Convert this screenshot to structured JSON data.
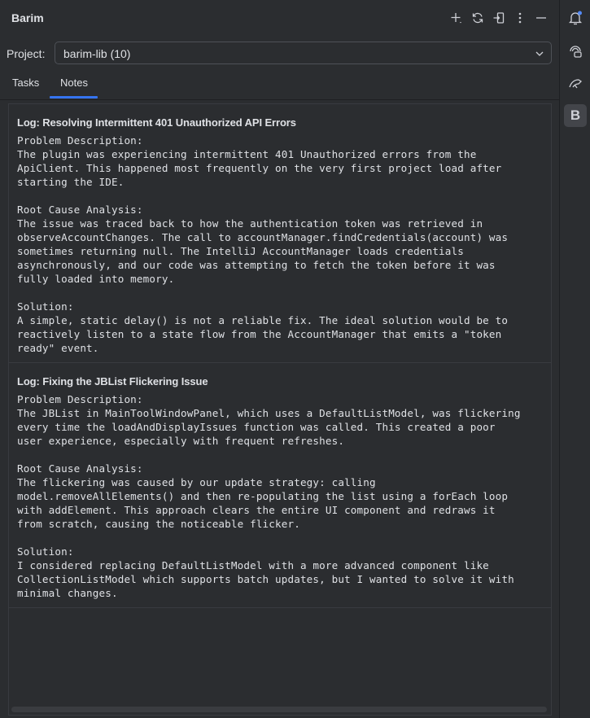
{
  "header": {
    "title": "Barim",
    "icons": [
      "add-icon",
      "refresh-icon",
      "logout-icon",
      "more-vertical-icon",
      "minimize-icon"
    ]
  },
  "project": {
    "label": "Project:",
    "selected": "barim-lib (10)"
  },
  "tabs": [
    {
      "label": "Tasks",
      "active": false
    },
    {
      "label": "Notes",
      "active": true
    }
  ],
  "notes": [
    {
      "title": "Log: Resolving Intermittent 401 Unauthorized API Errors",
      "body": "Problem Description:\nThe plugin was experiencing intermittent 401 Unauthorized errors from the\nApiClient. This happened most frequently on the very first project load after\nstarting the IDE.\n\nRoot Cause Analysis:\nThe issue was traced back to how the authentication token was retrieved in\nobserveAccountChanges. The call to accountManager.findCredentials(account) was\nsometimes returning null. The IntelliJ AccountManager loads credentials\nasynchronously, and our code was attempting to fetch the token before it was\nfully loaded into memory.\n\nSolution:\nA simple, static delay() is not a reliable fix. The ideal solution would be to\nreactively listen to a state flow from the AccountManager that emits a \"token\nready\" event."
    },
    {
      "title": "Log: Fixing the JBList Flickering Issue",
      "body": "Problem Description:\nThe JBList in MainToolWindowPanel, which uses a DefaultListModel, was flickering\nevery time the loadAndDisplayIssues function was called. This created a poor\nuser experience, especially with frequent refreshes.\n\nRoot Cause Analysis:\nThe flickering was caused by our update strategy: calling\nmodel.removeAllElements() and then re-populating the list using a forEach loop\nwith addElement. This approach clears the entire UI component and redraws it\nfrom scratch, causing the noticeable flicker.\n\nSolution:\nI considered replacing DefaultListModel with a more advanced component like\nCollectionListModel which supports batch updates, but I wanted to solve it with\nminimal changes."
    }
  ],
  "right_strip": {
    "icons": [
      "notifications-icon",
      "ai-assistant-icon",
      "database-icon",
      "barim-plugin-icon"
    ],
    "barim_letter": "B"
  },
  "colors": {
    "background": "#2b2d30",
    "accent": "#3574f0",
    "text": "#dfe1e5",
    "notification_dot": "#548af7"
  }
}
